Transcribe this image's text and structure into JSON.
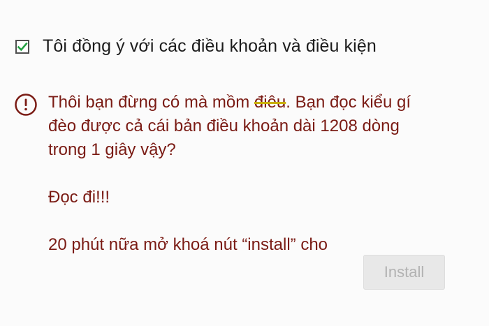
{
  "consent": {
    "checked": true,
    "label": "Tôi đồng ý với các điều khoản và điều kiện"
  },
  "warning": {
    "icon": "info-circle-icon",
    "line1_before": "Thôi bạn đừng có mà mồm ",
    "line1_struck": "điêu",
    "line1_after": ". Bạn đọc kiểu gí đèo được cả cái bản điều khoản dài 1208 dòng trong 1 giây vậy?",
    "line2": "Đọc đi!!!",
    "line3": "20 phút nữa mở khoá nút “install” cho"
  },
  "install_button": {
    "label": "Install",
    "enabled": false
  },
  "colors": {
    "warning_text": "#7a1b14",
    "check_mark": "#25a244",
    "strike": "#c9b000",
    "button_disabled_text": "#b2b2b2"
  }
}
